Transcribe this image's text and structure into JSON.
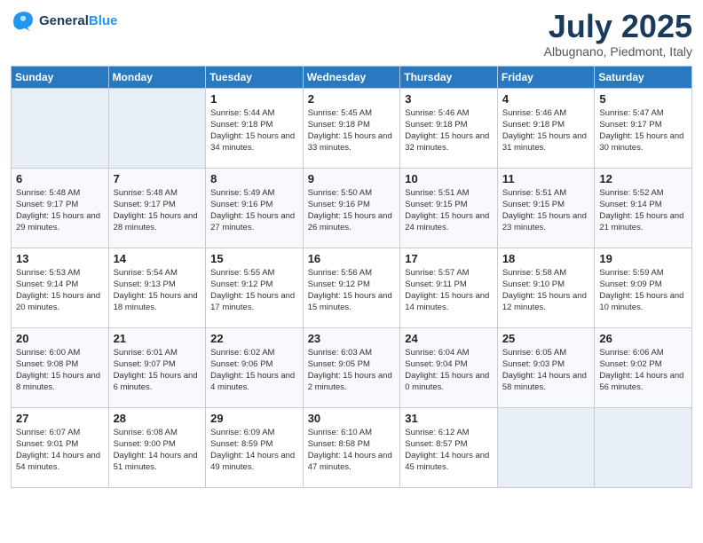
{
  "header": {
    "logo_line1": "General",
    "logo_line2": "Blue",
    "month": "July 2025",
    "location": "Albugnano, Piedmont, Italy"
  },
  "days_of_week": [
    "Sunday",
    "Monday",
    "Tuesday",
    "Wednesday",
    "Thursday",
    "Friday",
    "Saturday"
  ],
  "weeks": [
    [
      {
        "day": "",
        "empty": true
      },
      {
        "day": "",
        "empty": true
      },
      {
        "day": "1",
        "sunrise": "Sunrise: 5:44 AM",
        "sunset": "Sunset: 9:18 PM",
        "daylight": "Daylight: 15 hours and 34 minutes."
      },
      {
        "day": "2",
        "sunrise": "Sunrise: 5:45 AM",
        "sunset": "Sunset: 9:18 PM",
        "daylight": "Daylight: 15 hours and 33 minutes."
      },
      {
        "day": "3",
        "sunrise": "Sunrise: 5:46 AM",
        "sunset": "Sunset: 9:18 PM",
        "daylight": "Daylight: 15 hours and 32 minutes."
      },
      {
        "day": "4",
        "sunrise": "Sunrise: 5:46 AM",
        "sunset": "Sunset: 9:18 PM",
        "daylight": "Daylight: 15 hours and 31 minutes."
      },
      {
        "day": "5",
        "sunrise": "Sunrise: 5:47 AM",
        "sunset": "Sunset: 9:17 PM",
        "daylight": "Daylight: 15 hours and 30 minutes."
      }
    ],
    [
      {
        "day": "6",
        "sunrise": "Sunrise: 5:48 AM",
        "sunset": "Sunset: 9:17 PM",
        "daylight": "Daylight: 15 hours and 29 minutes."
      },
      {
        "day": "7",
        "sunrise": "Sunrise: 5:48 AM",
        "sunset": "Sunset: 9:17 PM",
        "daylight": "Daylight: 15 hours and 28 minutes."
      },
      {
        "day": "8",
        "sunrise": "Sunrise: 5:49 AM",
        "sunset": "Sunset: 9:16 PM",
        "daylight": "Daylight: 15 hours and 27 minutes."
      },
      {
        "day": "9",
        "sunrise": "Sunrise: 5:50 AM",
        "sunset": "Sunset: 9:16 PM",
        "daylight": "Daylight: 15 hours and 26 minutes."
      },
      {
        "day": "10",
        "sunrise": "Sunrise: 5:51 AM",
        "sunset": "Sunset: 9:15 PM",
        "daylight": "Daylight: 15 hours and 24 minutes."
      },
      {
        "day": "11",
        "sunrise": "Sunrise: 5:51 AM",
        "sunset": "Sunset: 9:15 PM",
        "daylight": "Daylight: 15 hours and 23 minutes."
      },
      {
        "day": "12",
        "sunrise": "Sunrise: 5:52 AM",
        "sunset": "Sunset: 9:14 PM",
        "daylight": "Daylight: 15 hours and 21 minutes."
      }
    ],
    [
      {
        "day": "13",
        "sunrise": "Sunrise: 5:53 AM",
        "sunset": "Sunset: 9:14 PM",
        "daylight": "Daylight: 15 hours and 20 minutes."
      },
      {
        "day": "14",
        "sunrise": "Sunrise: 5:54 AM",
        "sunset": "Sunset: 9:13 PM",
        "daylight": "Daylight: 15 hours and 18 minutes."
      },
      {
        "day": "15",
        "sunrise": "Sunrise: 5:55 AM",
        "sunset": "Sunset: 9:12 PM",
        "daylight": "Daylight: 15 hours and 17 minutes."
      },
      {
        "day": "16",
        "sunrise": "Sunrise: 5:56 AM",
        "sunset": "Sunset: 9:12 PM",
        "daylight": "Daylight: 15 hours and 15 minutes."
      },
      {
        "day": "17",
        "sunrise": "Sunrise: 5:57 AM",
        "sunset": "Sunset: 9:11 PM",
        "daylight": "Daylight: 15 hours and 14 minutes."
      },
      {
        "day": "18",
        "sunrise": "Sunrise: 5:58 AM",
        "sunset": "Sunset: 9:10 PM",
        "daylight": "Daylight: 15 hours and 12 minutes."
      },
      {
        "day": "19",
        "sunrise": "Sunrise: 5:59 AM",
        "sunset": "Sunset: 9:09 PM",
        "daylight": "Daylight: 15 hours and 10 minutes."
      }
    ],
    [
      {
        "day": "20",
        "sunrise": "Sunrise: 6:00 AM",
        "sunset": "Sunset: 9:08 PM",
        "daylight": "Daylight: 15 hours and 8 minutes."
      },
      {
        "day": "21",
        "sunrise": "Sunrise: 6:01 AM",
        "sunset": "Sunset: 9:07 PM",
        "daylight": "Daylight: 15 hours and 6 minutes."
      },
      {
        "day": "22",
        "sunrise": "Sunrise: 6:02 AM",
        "sunset": "Sunset: 9:06 PM",
        "daylight": "Daylight: 15 hours and 4 minutes."
      },
      {
        "day": "23",
        "sunrise": "Sunrise: 6:03 AM",
        "sunset": "Sunset: 9:05 PM",
        "daylight": "Daylight: 15 hours and 2 minutes."
      },
      {
        "day": "24",
        "sunrise": "Sunrise: 6:04 AM",
        "sunset": "Sunset: 9:04 PM",
        "daylight": "Daylight: 15 hours and 0 minutes."
      },
      {
        "day": "25",
        "sunrise": "Sunrise: 6:05 AM",
        "sunset": "Sunset: 9:03 PM",
        "daylight": "Daylight: 14 hours and 58 minutes."
      },
      {
        "day": "26",
        "sunrise": "Sunrise: 6:06 AM",
        "sunset": "Sunset: 9:02 PM",
        "daylight": "Daylight: 14 hours and 56 minutes."
      }
    ],
    [
      {
        "day": "27",
        "sunrise": "Sunrise: 6:07 AM",
        "sunset": "Sunset: 9:01 PM",
        "daylight": "Daylight: 14 hours and 54 minutes."
      },
      {
        "day": "28",
        "sunrise": "Sunrise: 6:08 AM",
        "sunset": "Sunset: 9:00 PM",
        "daylight": "Daylight: 14 hours and 51 minutes."
      },
      {
        "day": "29",
        "sunrise": "Sunrise: 6:09 AM",
        "sunset": "Sunset: 8:59 PM",
        "daylight": "Daylight: 14 hours and 49 minutes."
      },
      {
        "day": "30",
        "sunrise": "Sunrise: 6:10 AM",
        "sunset": "Sunset: 8:58 PM",
        "daylight": "Daylight: 14 hours and 47 minutes."
      },
      {
        "day": "31",
        "sunrise": "Sunrise: 6:12 AM",
        "sunset": "Sunset: 8:57 PM",
        "daylight": "Daylight: 14 hours and 45 minutes."
      },
      {
        "day": "",
        "empty": true
      },
      {
        "day": "",
        "empty": true
      }
    ]
  ],
  "colors": {
    "header_bg": "#2979c0",
    "header_text": "#ffffff",
    "title_color": "#1a3a5c",
    "even_row": "#ffffff",
    "odd_row": "#f7f9fc",
    "empty_cell": "#e8eef5"
  }
}
